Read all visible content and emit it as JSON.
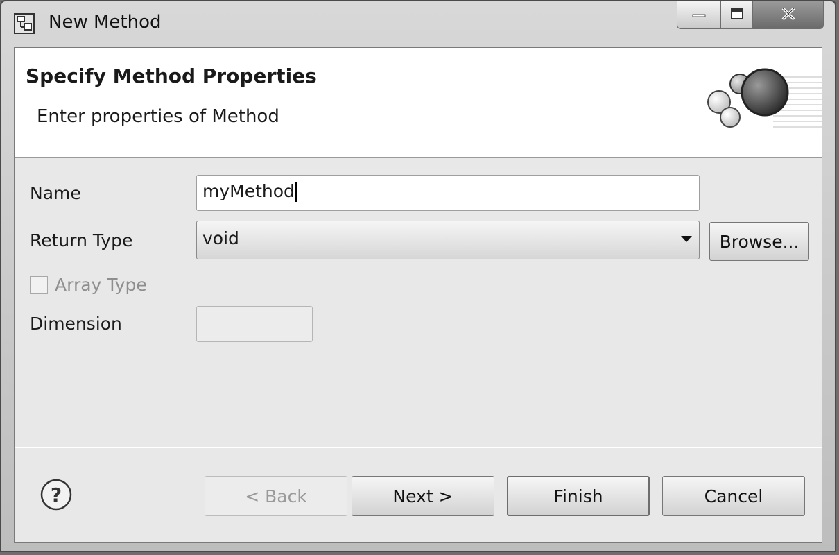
{
  "window": {
    "title": "New Method",
    "icon": "method-wizard-icon",
    "controls": [
      "minimize-icon",
      "maximize-icon",
      "close-icon"
    ]
  },
  "banner": {
    "title": "Specify Method Properties",
    "subtitle": "Enter properties of Method",
    "graphic": "spheres-wizard-icon"
  },
  "form": {
    "name_label": "Name",
    "name_value": "myMethod",
    "return_type_label": "Return Type",
    "return_type_value": "void",
    "browse_label": "Browse...",
    "array_type_label": "Array Type",
    "array_type_checked": false,
    "dimension_label": "Dimension",
    "dimension_value": ""
  },
  "footer": {
    "help_icon": "help-icon",
    "back_label": "< Back",
    "next_label": "Next >",
    "finish_label": "Finish",
    "cancel_label": "Cancel"
  }
}
